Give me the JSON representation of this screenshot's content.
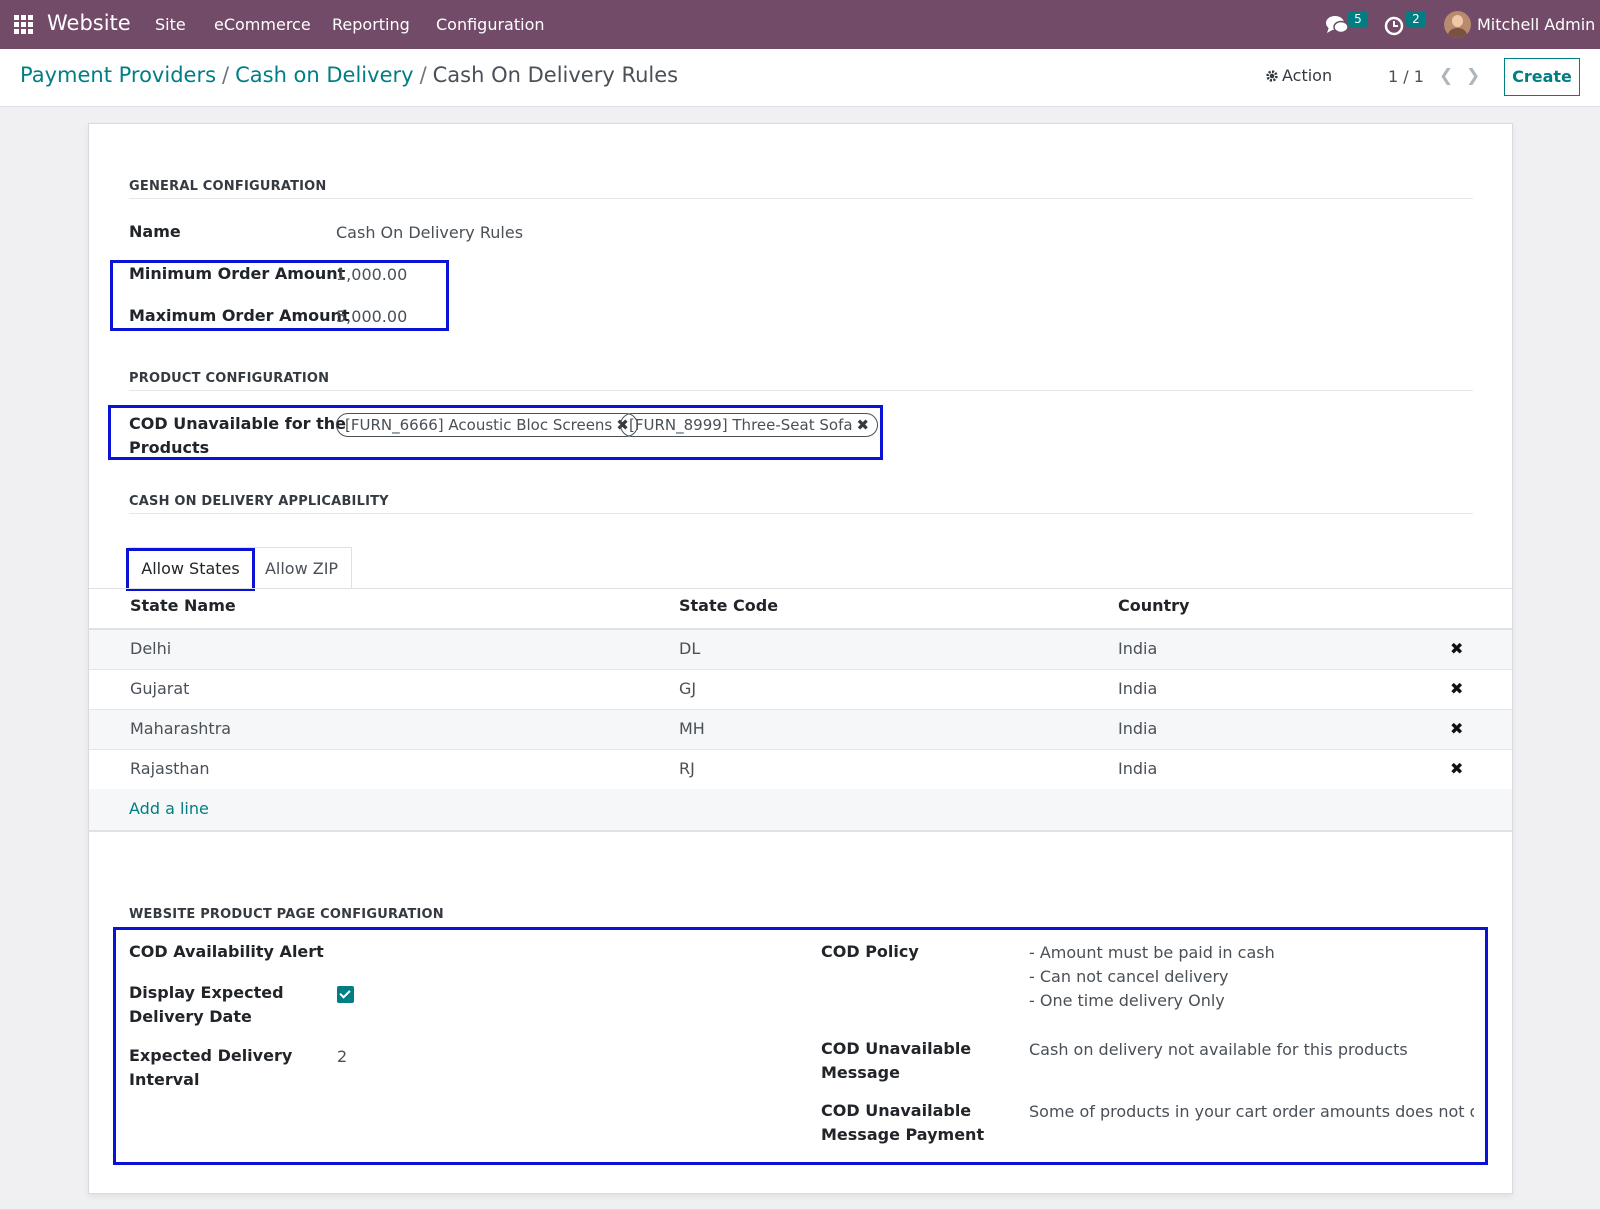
{
  "navbar": {
    "app_name": "Website",
    "menu": [
      "Site",
      "eCommerce",
      "Reporting",
      "Configuration"
    ],
    "messages_count": "5",
    "activities_count": "2",
    "user_name": "Mitchell Admin",
    "color": "#714b67"
  },
  "control": {
    "breadcrumb": [
      "Payment Providers",
      "Cash on Delivery",
      "Cash On Delivery Rules"
    ],
    "separator": "/",
    "action_label": "Action",
    "pager": "1 / 1",
    "create_label": "Create"
  },
  "form": {
    "general": {
      "title": "GENERAL CONFIGURATION",
      "name_label": "Name",
      "name_value": "Cash On Delivery Rules",
      "min_label": "Minimum Order Amount",
      "min_value": "1,000.00",
      "max_label": "Maximum Order Amount",
      "max_value": "5,000.00"
    },
    "product": {
      "title": "PRODUCT CONFIGURATION",
      "label_line1": "COD Unavailable for the",
      "label_line2": "Products",
      "tags": [
        "[FURN_6666] Acoustic Bloc Screens",
        "[FURN_8999] Three-Seat Sofa"
      ]
    },
    "applicability": {
      "title": "CASH ON DELIVERY APPLICABILITY",
      "tabs": [
        "Allow States",
        "Allow ZIP"
      ],
      "columns": [
        "State Name",
        "State Code",
        "Country"
      ],
      "rows": [
        [
          "Delhi",
          "DL",
          "India"
        ],
        [
          "Gujarat",
          "GJ",
          "India"
        ],
        [
          "Maharashtra",
          "MH",
          "India"
        ],
        [
          "Rajasthan",
          "RJ",
          "India"
        ]
      ],
      "add_line": "Add a line"
    },
    "website": {
      "title": "WEBSITE PRODUCT PAGE CONFIGURATION",
      "alert_label": "COD Availability Alert",
      "display_label_1": "Display Expected",
      "display_label_2": "Delivery Date",
      "display_checked": true,
      "interval_label_1": "Expected Delivery",
      "interval_label_2": "Interval",
      "interval_value": "2",
      "policy_label": "COD Policy",
      "policy_lines": [
        "- Amount must be paid in cash",
        "- Can not cancel delivery",
        "- One time delivery Only"
      ],
      "msg_label_1": "COD Unavailable",
      "msg_label_2": "Message",
      "msg_value": "Cash on delivery not available for this products",
      "pay_label_1": "COD Unavailable",
      "pay_label_2": "Message Payment",
      "pay_value": "Some of products in your cart order amounts does not qualif"
    }
  },
  "colors": {
    "primary": "#714b67",
    "link": "#017e84",
    "highlight": "#0a12d6"
  }
}
